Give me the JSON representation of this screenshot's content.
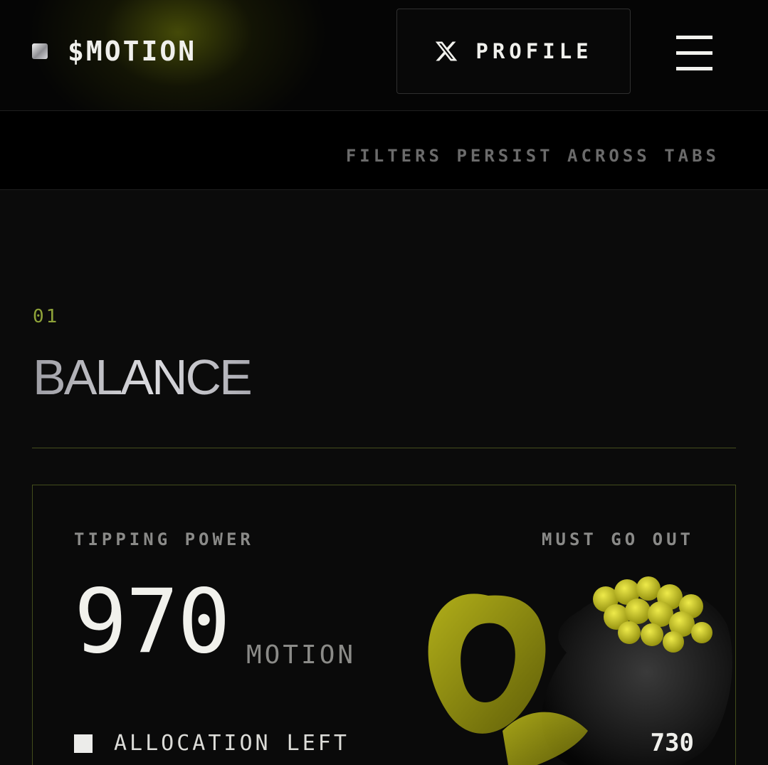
{
  "header": {
    "brand_name": "$MOTION",
    "profile_button_label": "PROFILE",
    "profile_icon": "x-logo-icon",
    "menu_icon": "hamburger-menu-icon"
  },
  "filter_bar": {
    "note": "FILTERS PERSIST ACROSS TABS"
  },
  "section": {
    "number": "01",
    "title": "BALANCE"
  },
  "balance_card": {
    "label_left": "TIPPING POWER",
    "label_right": "MUST GO OUT",
    "value": "970",
    "unit": "MOTION",
    "allocation_label": "ALLOCATION LEFT",
    "allocation_value": "730",
    "illustration": "coin-pot-illustration"
  },
  "colors": {
    "accent": "#8fa339",
    "border_accent": "#434d1c",
    "background": "#0b0b0b",
    "coin_yellow": "#d6d31e"
  }
}
